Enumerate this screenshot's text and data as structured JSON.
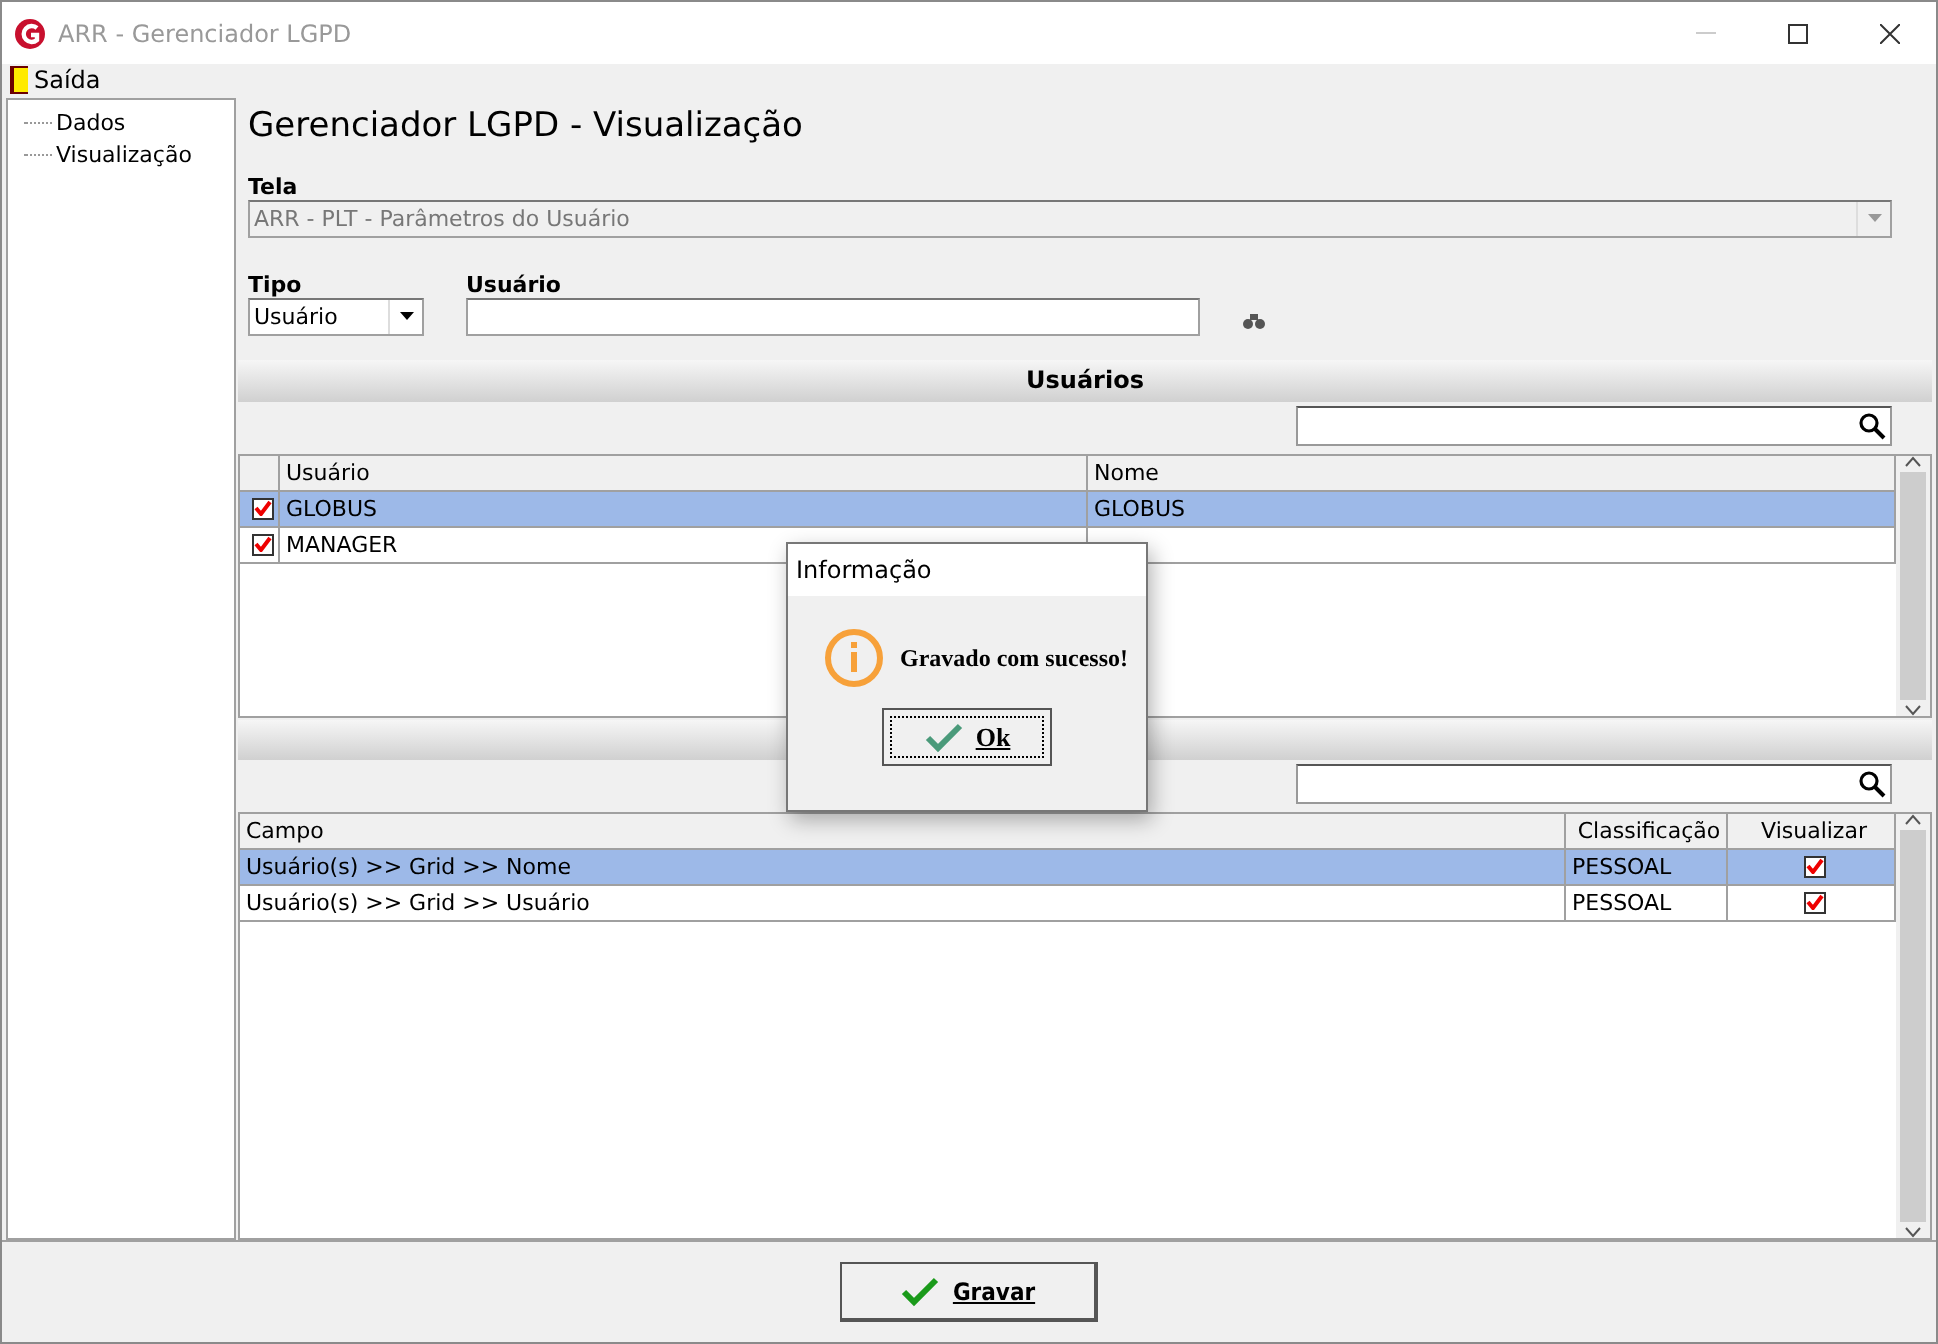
{
  "window": {
    "title": "ARR - Gerenciador LGPD"
  },
  "menu": [
    {
      "label": "Saída"
    }
  ],
  "sidebar": {
    "items": [
      {
        "label": "Dados",
        "selected": false
      },
      {
        "label": "Visualização",
        "selected": false
      }
    ]
  },
  "heading": "Gerenciador LGPD - Visualização",
  "tela": {
    "label": "Tela",
    "value": "ARR - PLT - Parâmetros do Usuário",
    "disabled": true
  },
  "tipo": {
    "label": "Tipo",
    "value": "Usuário"
  },
  "usuario": {
    "label": "Usuário"
  },
  "users_section": {
    "title": "Usuários",
    "columns": [
      "Usuário",
      "Nome"
    ],
    "rows": [
      {
        "checked": true,
        "selected": true,
        "cells": [
          "GLOBUS",
          "GLOBUS"
        ]
      },
      {
        "checked": true,
        "selected": false,
        "cells": [
          "MANAGER",
          ""
        ]
      }
    ]
  },
  "fields_section": {
    "columns": [
      "Campo",
      "Classificação",
      "Visualizar"
    ],
    "rows": [
      {
        "selected": true,
        "checked": true,
        "cells": [
          "Usuário(s) >> Grid >> Nome",
          "PESSOAL"
        ]
      },
      {
        "selected": false,
        "checked": true,
        "cells": [
          "Usuário(s) >> Grid >> Usuário",
          "PESSOAL"
        ]
      }
    ]
  },
  "dialog": {
    "title": "Informação",
    "message": "Gravado com sucesso!",
    "button": "Ok"
  },
  "footer": {
    "button": "Gravar"
  }
}
